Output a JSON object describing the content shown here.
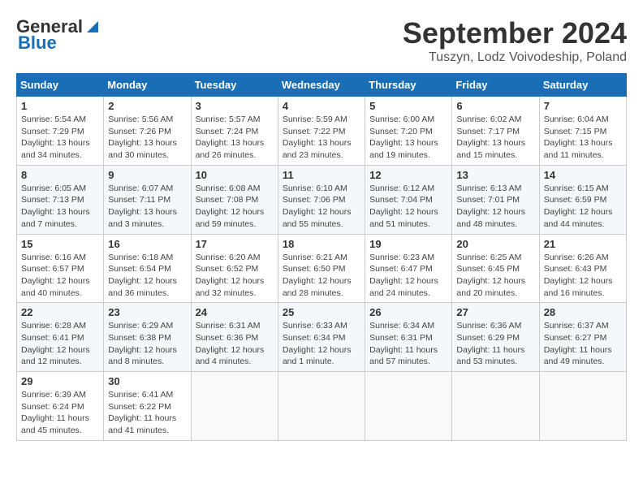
{
  "logo": {
    "line1": "General",
    "line2": "Blue"
  },
  "title": "September 2024",
  "location": "Tuszyn, Lodz Voivodeship, Poland",
  "weekdays": [
    "Sunday",
    "Monday",
    "Tuesday",
    "Wednesday",
    "Thursday",
    "Friday",
    "Saturday"
  ],
  "weeks": [
    [
      {
        "day": 1,
        "sunrise": "5:54 AM",
        "sunset": "7:29 PM",
        "daylight": "13 hours and 34 minutes."
      },
      {
        "day": 2,
        "sunrise": "5:56 AM",
        "sunset": "7:26 PM",
        "daylight": "13 hours and 30 minutes."
      },
      {
        "day": 3,
        "sunrise": "5:57 AM",
        "sunset": "7:24 PM",
        "daylight": "13 hours and 26 minutes."
      },
      {
        "day": 4,
        "sunrise": "5:59 AM",
        "sunset": "7:22 PM",
        "daylight": "13 hours and 23 minutes."
      },
      {
        "day": 5,
        "sunrise": "6:00 AM",
        "sunset": "7:20 PM",
        "daylight": "13 hours and 19 minutes."
      },
      {
        "day": 6,
        "sunrise": "6:02 AM",
        "sunset": "7:17 PM",
        "daylight": "13 hours and 15 minutes."
      },
      {
        "day": 7,
        "sunrise": "6:04 AM",
        "sunset": "7:15 PM",
        "daylight": "13 hours and 11 minutes."
      }
    ],
    [
      {
        "day": 8,
        "sunrise": "6:05 AM",
        "sunset": "7:13 PM",
        "daylight": "13 hours and 7 minutes."
      },
      {
        "day": 9,
        "sunrise": "6:07 AM",
        "sunset": "7:11 PM",
        "daylight": "13 hours and 3 minutes."
      },
      {
        "day": 10,
        "sunrise": "6:08 AM",
        "sunset": "7:08 PM",
        "daylight": "12 hours and 59 minutes."
      },
      {
        "day": 11,
        "sunrise": "6:10 AM",
        "sunset": "7:06 PM",
        "daylight": "12 hours and 55 minutes."
      },
      {
        "day": 12,
        "sunrise": "6:12 AM",
        "sunset": "7:04 PM",
        "daylight": "12 hours and 51 minutes."
      },
      {
        "day": 13,
        "sunrise": "6:13 AM",
        "sunset": "7:01 PM",
        "daylight": "12 hours and 48 minutes."
      },
      {
        "day": 14,
        "sunrise": "6:15 AM",
        "sunset": "6:59 PM",
        "daylight": "12 hours and 44 minutes."
      }
    ],
    [
      {
        "day": 15,
        "sunrise": "6:16 AM",
        "sunset": "6:57 PM",
        "daylight": "12 hours and 40 minutes."
      },
      {
        "day": 16,
        "sunrise": "6:18 AM",
        "sunset": "6:54 PM",
        "daylight": "12 hours and 36 minutes."
      },
      {
        "day": 17,
        "sunrise": "6:20 AM",
        "sunset": "6:52 PM",
        "daylight": "12 hours and 32 minutes."
      },
      {
        "day": 18,
        "sunrise": "6:21 AM",
        "sunset": "6:50 PM",
        "daylight": "12 hours and 28 minutes."
      },
      {
        "day": 19,
        "sunrise": "6:23 AM",
        "sunset": "6:47 PM",
        "daylight": "12 hours and 24 minutes."
      },
      {
        "day": 20,
        "sunrise": "6:25 AM",
        "sunset": "6:45 PM",
        "daylight": "12 hours and 20 minutes."
      },
      {
        "day": 21,
        "sunrise": "6:26 AM",
        "sunset": "6:43 PM",
        "daylight": "12 hours and 16 minutes."
      }
    ],
    [
      {
        "day": 22,
        "sunrise": "6:28 AM",
        "sunset": "6:41 PM",
        "daylight": "12 hours and 12 minutes."
      },
      {
        "day": 23,
        "sunrise": "6:29 AM",
        "sunset": "6:38 PM",
        "daylight": "12 hours and 8 minutes."
      },
      {
        "day": 24,
        "sunrise": "6:31 AM",
        "sunset": "6:36 PM",
        "daylight": "12 hours and 4 minutes."
      },
      {
        "day": 25,
        "sunrise": "6:33 AM",
        "sunset": "6:34 PM",
        "daylight": "12 hours and 1 minute."
      },
      {
        "day": 26,
        "sunrise": "6:34 AM",
        "sunset": "6:31 PM",
        "daylight": "11 hours and 57 minutes."
      },
      {
        "day": 27,
        "sunrise": "6:36 AM",
        "sunset": "6:29 PM",
        "daylight": "11 hours and 53 minutes."
      },
      {
        "day": 28,
        "sunrise": "6:37 AM",
        "sunset": "6:27 PM",
        "daylight": "11 hours and 49 minutes."
      }
    ],
    [
      {
        "day": 29,
        "sunrise": "6:39 AM",
        "sunset": "6:24 PM",
        "daylight": "11 hours and 45 minutes."
      },
      {
        "day": 30,
        "sunrise": "6:41 AM",
        "sunset": "6:22 PM",
        "daylight": "11 hours and 41 minutes."
      },
      null,
      null,
      null,
      null,
      null
    ]
  ]
}
